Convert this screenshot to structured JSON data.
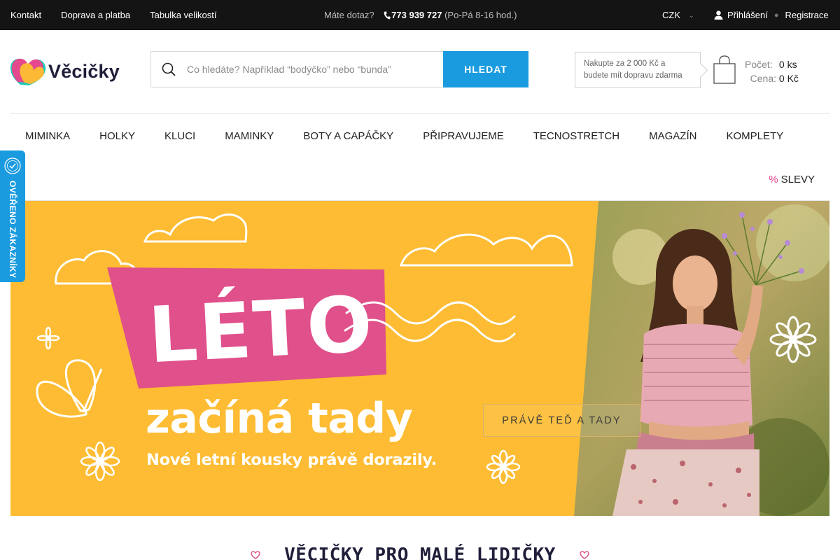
{
  "topbar": {
    "links": [
      "Kontakt",
      "Doprava a platba",
      "Tabulka velikostí"
    ],
    "question": "Máte dotaz?",
    "phone": "773 939 727",
    "hours": "(Po-Pá 8-16 hod.)",
    "currency": "CZK",
    "login": "Přihlášení",
    "register": "Registrace"
  },
  "header": {
    "logo_text": "Věcičky",
    "search_placeholder": "Co hledáte? Například “bodýčko” nebo “bunda”",
    "search_button": "HLEDAT",
    "promo_text": "Nakupte za 2 000 Kč a budete mít dopravu zdarma",
    "cart": {
      "count_label": "Počet:",
      "count_value": "0 ks",
      "price_label": "Cena:",
      "price_value": "0 Kč"
    }
  },
  "nav": {
    "items": [
      "MIMINKA",
      "HOLKY",
      "KLUCI",
      "MAMINKY",
      "BOTY A CAPÁČKY",
      "PŘIPRAVUJEME",
      "TECNOSTRETCH",
      "MAGAZÍN",
      "KOMPLETY"
    ],
    "sale_symbol": "%",
    "sale_label": "SLEVY"
  },
  "badge": {
    "text": "OVĚŘENO ZÁKAZNÍKY"
  },
  "hero": {
    "title": "LÉTO",
    "headline": "začíná tady",
    "subline": "Nové letní kousky právě dorazily.",
    "cta": "PRÁVĚ TEĎ A TADY"
  },
  "section": {
    "title": "VĚCIČKY PRO MALÉ LIDIČKY"
  },
  "colors": {
    "accent_blue": "#1a9be0",
    "hero_yellow": "#fdbc33",
    "hero_pink": "#e0508a",
    "topbar_bg": "#141414"
  }
}
